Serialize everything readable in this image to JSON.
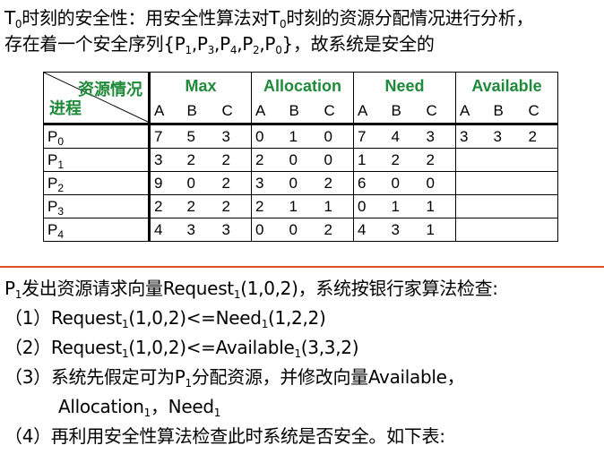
{
  "intro": {
    "l1_t": "T",
    "l1_t_sub": "0",
    "l1_a": "时刻的安全性：用安全性算法对",
    "l1_t2": "T",
    "l1_t2_sub": "0",
    "l1_b": "时刻的资源分配情况进行分析，",
    "l2_a": "存在着一个安全序列{P",
    "s1": "1",
    "c1": ",P",
    "s2": "3",
    "c2": ",P",
    "s3": "4",
    "c3": ",P",
    "s4": "2",
    "c4": ",P",
    "s5": "0",
    "l2_b": "}，故系统是安全的"
  },
  "table": {
    "corner_top": "资源情况",
    "corner_bottom": "进程",
    "groups": [
      "Max",
      "Allocation",
      "Need",
      "Available"
    ],
    "letters": [
      "A",
      "B",
      "C"
    ],
    "rows": [
      {
        "p": "P",
        "sub": "0",
        "max": [
          "7",
          "5",
          "3"
        ],
        "alloc": [
          "0",
          "1",
          "0"
        ],
        "need": [
          "7",
          "4",
          "3"
        ],
        "avail": [
          "3",
          "3",
          "2"
        ]
      },
      {
        "p": "P",
        "sub": "1",
        "max": [
          "3",
          "2",
          "2"
        ],
        "alloc": [
          "2",
          "0",
          "0"
        ],
        "need": [
          "1",
          "2",
          "2"
        ],
        "avail": [
          "",
          "",
          ""
        ]
      },
      {
        "p": "P",
        "sub": "2",
        "max": [
          "9",
          "0",
          "2"
        ],
        "alloc": [
          "3",
          "0",
          "2"
        ],
        "need": [
          "6",
          "0",
          "0"
        ],
        "avail": [
          "",
          "",
          ""
        ]
      },
      {
        "p": "P",
        "sub": "3",
        "max": [
          "2",
          "2",
          "2"
        ],
        "alloc": [
          "2",
          "1",
          "1"
        ],
        "need": [
          "0",
          "1",
          "1"
        ],
        "avail": [
          "",
          "",
          ""
        ]
      },
      {
        "p": "P",
        "sub": "4",
        "max": [
          "4",
          "3",
          "3"
        ],
        "alloc": [
          "0",
          "0",
          "2"
        ],
        "need": [
          "4",
          "3",
          "1"
        ],
        "avail": [
          "",
          "",
          ""
        ]
      }
    ]
  },
  "request": {
    "l1_p": "P",
    "l1_sub": "1",
    "l1_text": "发出资源请求向量Request",
    "l1_sub2": "1",
    "l1_tail": "(1,0,2)，系统按银行家算法检查:",
    "l2_a": "（1）Request",
    "l2_s1": "1",
    "l2_b": "(1,0,2)<=Need",
    "l2_s2": "1",
    "l2_c": "(1,2,2)",
    "l3_a": "（2）Request",
    "l3_s1": "1",
    "l3_b": "(1,0,2)<=Available",
    "l3_s2": "1",
    "l3_c": "(3,3,2)",
    "l4_a": "（3）系统先假定可为P",
    "l4_s1": "1",
    "l4_b": "分配资源，并修改向量Available，",
    "l5_a": "Allocation",
    "l5_s1": "1",
    "l5_b": "，Need",
    "l5_s2": "1",
    "l6": "（4）再利用安全性算法检查此时系统是否安全。如下表:"
  }
}
